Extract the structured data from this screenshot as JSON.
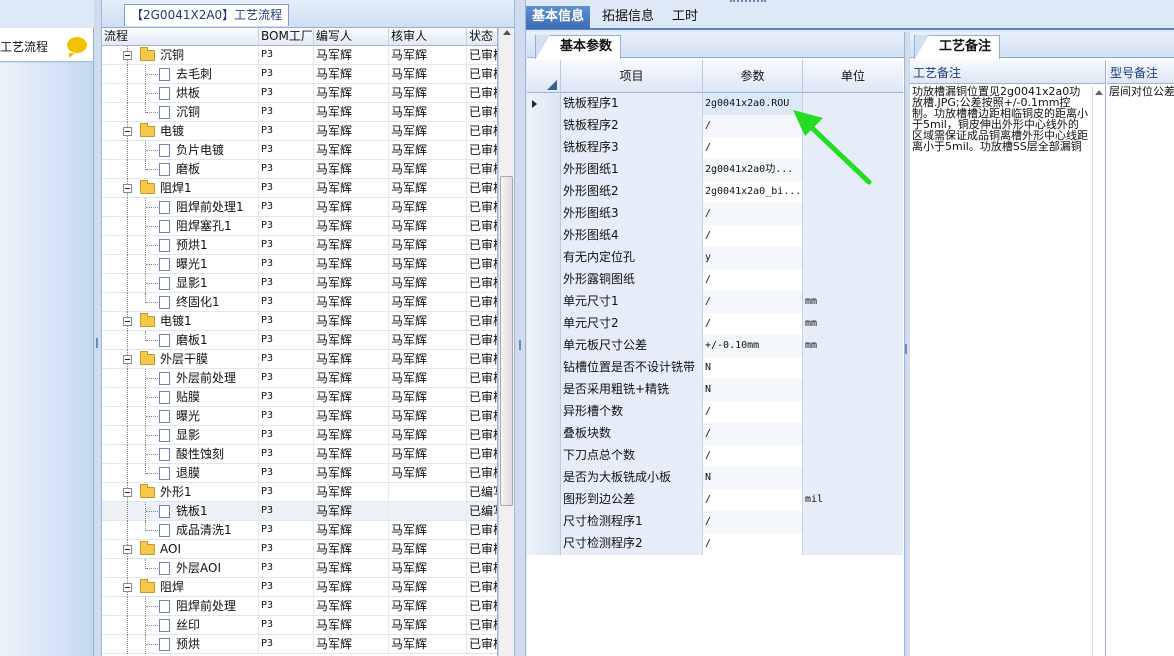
{
  "left_strip": {
    "title": "工艺流程"
  },
  "flow_tab": {
    "label": "【2G0041X2A0】工艺流程"
  },
  "tree": {
    "headers": [
      "流程",
      "BOM工厂",
      "编写人",
      "核审人",
      "状态"
    ],
    "rows": [
      {
        "label": "沉铜",
        "bom": "P3",
        "writer": "马军辉",
        "reviewer": "马军辉",
        "status": "已审核"
      },
      {
        "label": "去毛刺",
        "bom": "P3",
        "writer": "马军辉",
        "reviewer": "马军辉",
        "status": "已审核"
      },
      {
        "label": "烘板",
        "bom": "P3",
        "writer": "马军辉",
        "reviewer": "马军辉",
        "status": "已审核"
      },
      {
        "label": "沉铜",
        "bom": "P3",
        "writer": "马军辉",
        "reviewer": "马军辉",
        "status": "已审核"
      },
      {
        "label": "电镀",
        "bom": "P3",
        "writer": "马军辉",
        "reviewer": "马军辉",
        "status": "已审核"
      },
      {
        "label": "负片电镀",
        "bom": "P3",
        "writer": "马军辉",
        "reviewer": "马军辉",
        "status": "已审核"
      },
      {
        "label": "磨板",
        "bom": "P3",
        "writer": "马军辉",
        "reviewer": "马军辉",
        "status": "已审核"
      },
      {
        "label": "阻焊1",
        "bom": "P3",
        "writer": "马军辉",
        "reviewer": "马军辉",
        "status": "已审核"
      },
      {
        "label": "阻焊前处理1",
        "bom": "P3",
        "writer": "马军辉",
        "reviewer": "马军辉",
        "status": "已审核"
      },
      {
        "label": "阻焊塞孔1",
        "bom": "P3",
        "writer": "马军辉",
        "reviewer": "马军辉",
        "status": "已审核"
      },
      {
        "label": "预烘1",
        "bom": "P3",
        "writer": "马军辉",
        "reviewer": "马军辉",
        "status": "已审核"
      },
      {
        "label": "曝光1",
        "bom": "P3",
        "writer": "马军辉",
        "reviewer": "马军辉",
        "status": "已审核"
      },
      {
        "label": "显影1",
        "bom": "P3",
        "writer": "马军辉",
        "reviewer": "马军辉",
        "status": "已审核"
      },
      {
        "label": "终固化1",
        "bom": "P3",
        "writer": "马军辉",
        "reviewer": "马军辉",
        "status": "已审核"
      },
      {
        "label": "电镀1",
        "bom": "P3",
        "writer": "马军辉",
        "reviewer": "马军辉",
        "status": "已审核"
      },
      {
        "label": "磨板1",
        "bom": "P3",
        "writer": "马军辉",
        "reviewer": "马军辉",
        "status": "已审核"
      },
      {
        "label": "外层干膜",
        "bom": "P3",
        "writer": "马军辉",
        "reviewer": "马军辉",
        "status": "已审核"
      },
      {
        "label": "外层前处理",
        "bom": "P3",
        "writer": "马军辉",
        "reviewer": "马军辉",
        "status": "已审核"
      },
      {
        "label": "贴膜",
        "bom": "P3",
        "writer": "马军辉",
        "reviewer": "马军辉",
        "status": "已审核"
      },
      {
        "label": "曝光",
        "bom": "P3",
        "writer": "马军辉",
        "reviewer": "马军辉",
        "status": "已审核"
      },
      {
        "label": "显影",
        "bom": "P3",
        "writer": "马军辉",
        "reviewer": "马军辉",
        "status": "已审核"
      },
      {
        "label": "酸性蚀刻",
        "bom": "P3",
        "writer": "马军辉",
        "reviewer": "马军辉",
        "status": "已审核"
      },
      {
        "label": "退膜",
        "bom": "P3",
        "writer": "马军辉",
        "reviewer": "马军辉",
        "status": "已审核"
      },
      {
        "label": "外形1",
        "bom": "P3",
        "writer": "马军辉",
        "reviewer": "",
        "status": "已编写"
      },
      {
        "label": "铣板1",
        "bom": "P3",
        "writer": "马军辉",
        "reviewer": "",
        "status": "已编写"
      },
      {
        "label": "成品清洗1",
        "bom": "P3",
        "writer": "马军辉",
        "reviewer": "马军辉",
        "status": "已审核"
      },
      {
        "label": "AOI",
        "bom": "P3",
        "writer": "马军辉",
        "reviewer": "马军辉",
        "status": "已审核"
      },
      {
        "label": "外层AOI",
        "bom": "P3",
        "writer": "马军辉",
        "reviewer": "马军辉",
        "status": "已审核"
      },
      {
        "label": "阻焊",
        "bom": "P3",
        "writer": "马军辉",
        "reviewer": "马军辉",
        "status": "已审核"
      },
      {
        "label": "阻焊前处理",
        "bom": "P3",
        "writer": "马军辉",
        "reviewer": "马军辉",
        "status": "已审核"
      },
      {
        "label": "丝印",
        "bom": "P3",
        "writer": "马军辉",
        "reviewer": "马军辉",
        "status": "已审核"
      },
      {
        "label": "预烘",
        "bom": "P3",
        "writer": "马军辉",
        "reviewer": "马军辉",
        "status": "已审核"
      }
    ]
  },
  "main_tabs": [
    "基本信息",
    "拓据信息",
    "工时"
  ],
  "param_panel": {
    "tab": "基本参数",
    "headers": [
      "项目",
      "参数",
      "单位"
    ],
    "rows": [
      {
        "item": "铣板程序1",
        "value": "2g0041x2a0.ROU",
        "unit": ""
      },
      {
        "item": "铣板程序2",
        "value": "/",
        "unit": ""
      },
      {
        "item": "铣板程序3",
        "value": "/",
        "unit": ""
      },
      {
        "item": "外形图纸1",
        "value": "2g0041x2a0功...",
        "unit": ""
      },
      {
        "item": "外形图纸2",
        "value": "2g0041x2a0_bi...",
        "unit": ""
      },
      {
        "item": "外形图纸3",
        "value": "/",
        "unit": ""
      },
      {
        "item": "外形图纸4",
        "value": "/",
        "unit": ""
      },
      {
        "item": "有无内定位孔",
        "value": "y",
        "unit": ""
      },
      {
        "item": "外形露铜图纸",
        "value": "/",
        "unit": ""
      },
      {
        "item": "单元尺寸1",
        "value": "/",
        "unit": "mm"
      },
      {
        "item": "单元尺寸2",
        "value": "/",
        "unit": "mm"
      },
      {
        "item": "单元板尺寸公差",
        "value": "+/-0.10mm",
        "unit": "mm"
      },
      {
        "item": "钻槽位置是否不设计铣带",
        "value": "N",
        "unit": ""
      },
      {
        "item": "是否采用粗铣+精铣",
        "value": "N",
        "unit": ""
      },
      {
        "item": "异形槽个数",
        "value": "/",
        "unit": ""
      },
      {
        "item": "叠板块数",
        "value": "/",
        "unit": ""
      },
      {
        "item": "下刀点总个数",
        "value": "/",
        "unit": ""
      },
      {
        "item": "是否为大板铣成小板",
        "value": "N",
        "unit": ""
      },
      {
        "item": "图形到边公差",
        "value": "/",
        "unit": "mil"
      },
      {
        "item": "尺寸检测程序1",
        "value": "/",
        "unit": ""
      },
      {
        "item": "尺寸检测程序2",
        "value": "/",
        "unit": ""
      }
    ]
  },
  "remark_panel": {
    "tab": "工艺备注",
    "col1_header": "工艺备注",
    "col1_text": "功放槽漏铜位置见2g0041x2a0功放槽.JPG;公差按照+/-0.1mm控制。功放槽槽边距相临铜皮的距离小于5mil，铜皮伸出外形中心线外的区域需保证成品铜离槽外形中心线距离小于5mil。功放槽SS层全部漏铜",
    "col2_header": "型号备注",
    "col2_text": "层间对位公差"
  },
  "colors": {
    "accent_tab": "#3c6db4",
    "annotation_arrow": "#22dd22"
  }
}
